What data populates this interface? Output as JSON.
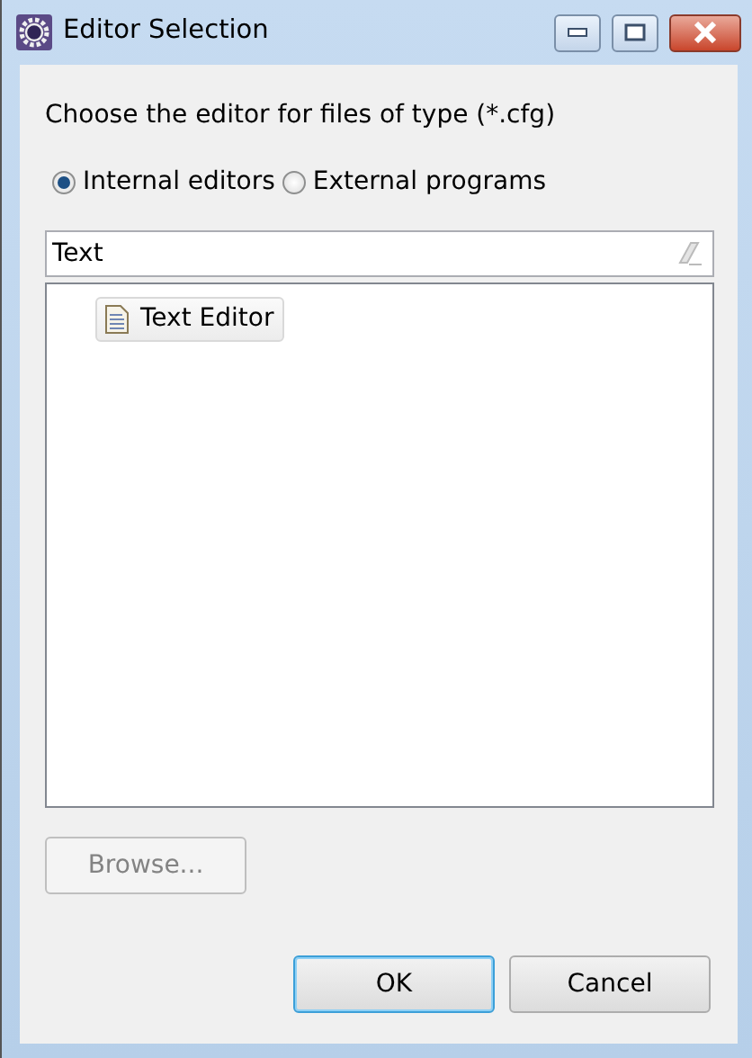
{
  "window": {
    "title": "Editor Selection"
  },
  "prompt": "Choose the editor for files of type (*.cfg)",
  "editor_source": [
    {
      "label": "Internal editors",
      "selected": true
    },
    {
      "label": "External programs",
      "selected": false
    }
  ],
  "filter": {
    "value": "Text"
  },
  "editors": [
    {
      "label": "Text Editor",
      "selected": true
    }
  ],
  "browse_button": {
    "label": "Browse...",
    "disabled": true
  },
  "buttons": [
    {
      "label": "OK",
      "default": true
    },
    {
      "label": "Cancel",
      "default": false
    }
  ]
}
